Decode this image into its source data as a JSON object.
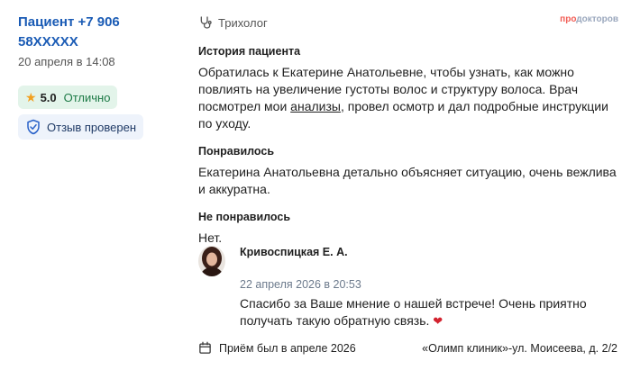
{
  "patient": {
    "name": "Пациент +7 906 58XXXXX",
    "date": "20 апреля в 14:08",
    "rating_score": "5.0",
    "rating_word": "Отлично",
    "verified_label": "Отзыв проверен"
  },
  "doctor": {
    "specialty": "Трихолог"
  },
  "brand": {
    "pro": "про",
    "rest": "докторов"
  },
  "sections": {
    "history_title": "История пациента",
    "history_part1": "Обратилась к Екатерине Анатольевне, чтобы узнать, как можно повлиять на увеличение густоты волос и структуру волоса. Врач посмотрел мои ",
    "history_link": "анализы",
    "history_part2": ", провел осмотр и дал подробные инструкции по уходу.",
    "liked_title": "Понравилось",
    "liked_text": "Екатерина Анатольевна детально объясняет ситуацию, очень вежлива и аккуратна.",
    "disliked_title": "Не понравилось",
    "disliked_text": "Нет."
  },
  "reply": {
    "author": "Кривоспицкая Е. А.",
    "date": "22 апреля 2026 в 20:53",
    "text": "Спасибо за Ваше мнение о нашей встрече! Очень приятно получать такую обратную связь.",
    "emoji": "❤"
  },
  "footer": {
    "visit": "Приём был в апреле  2026",
    "clinic": "«Олимп клиник»-ул. Моисеева, д. 2/2"
  },
  "colors": {
    "link_blue": "#1a5bb5",
    "rating_bg": "#e3f4ea",
    "verified_bg": "#eef3fb",
    "star": "#f2a01f",
    "heart": "#d3232f",
    "brand_red": "#f25c54"
  }
}
